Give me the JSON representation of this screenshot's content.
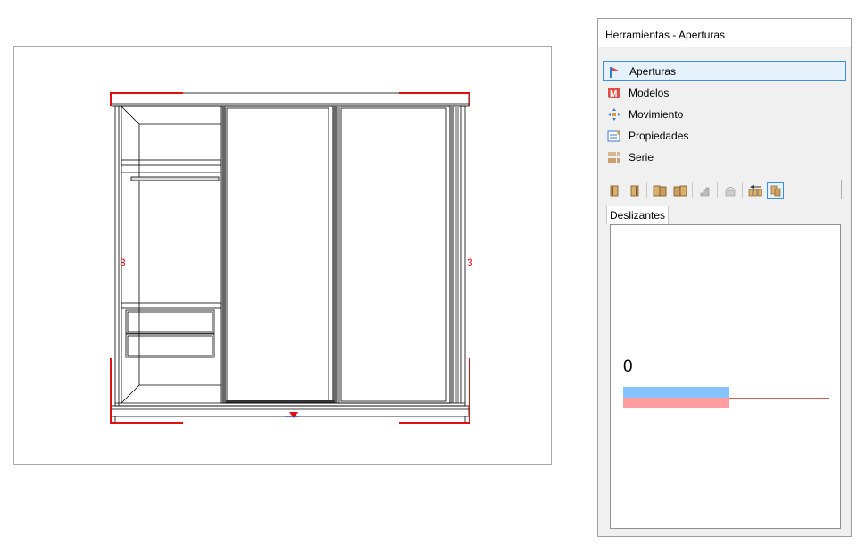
{
  "panel": {
    "title": "Herramientas - Aperturas",
    "sections": [
      {
        "label": "Aperturas",
        "icon": "aperturas-icon",
        "active": true
      },
      {
        "label": "Modelos",
        "icon": "modelos-icon",
        "active": false
      },
      {
        "label": "Movimiento",
        "icon": "move-icon",
        "active": false
      },
      {
        "label": "Propiedades",
        "icon": "properties-icon",
        "active": false
      },
      {
        "label": "Serie",
        "icon": "serie-icon",
        "active": false
      }
    ],
    "toolbar_icons": [
      "single-door-left-icon",
      "single-door-right-icon",
      "double-door-icon",
      "double-door-alt-icon",
      "stair-icon",
      "lift-door-icon",
      "sliding-arrow-icon",
      "sliding-door-icon"
    ],
    "tab_label": "Deslizantes",
    "count": "0"
  },
  "colors": {
    "accent": "#3c8fd8",
    "blue_bar": "#86c3ff",
    "red_bar": "#ff9ea0",
    "marker_red": "#e01010"
  },
  "canvas": {
    "marker_left": "3",
    "marker_right": "3"
  }
}
